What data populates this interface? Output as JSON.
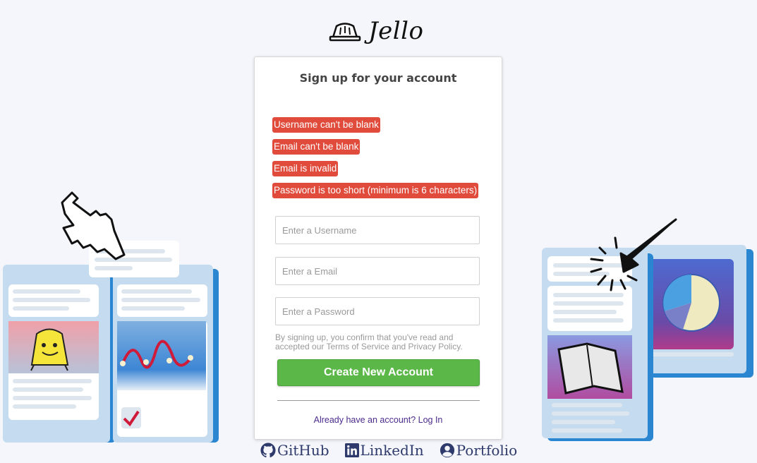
{
  "brand": {
    "name": "Jello",
    "logo_icon": "jello-mold-icon"
  },
  "form": {
    "title": "Sign up for your account",
    "errors": [
      "Username can't be blank",
      "Email can't be blank",
      "Email is invalid",
      "Password is too short (minimum is 6 characters)"
    ],
    "username_placeholder": "Enter a Username",
    "email_placeholder": "Enter a Email",
    "password_placeholder": "Enter a Password",
    "terms": "By signing up, you confirm that you've read and accepted our Terms of Service and Privacy Policy.",
    "submit_label": "Create New Account",
    "login_link": "Already have an account? Log In"
  },
  "footer": {
    "links": [
      {
        "label": "GitHub",
        "icon": "github-icon"
      },
      {
        "label": "LinkedIn",
        "icon": "linkedin-icon"
      },
      {
        "label": "Portfolio",
        "icon": "user-circle-icon"
      }
    ]
  },
  "colors": {
    "error_bg": "#e04b3c",
    "primary_button": "#5bb848",
    "link": "#4b2b8c",
    "footer_link": "#2e3a6b",
    "page_bg": "#f4f6fb"
  }
}
